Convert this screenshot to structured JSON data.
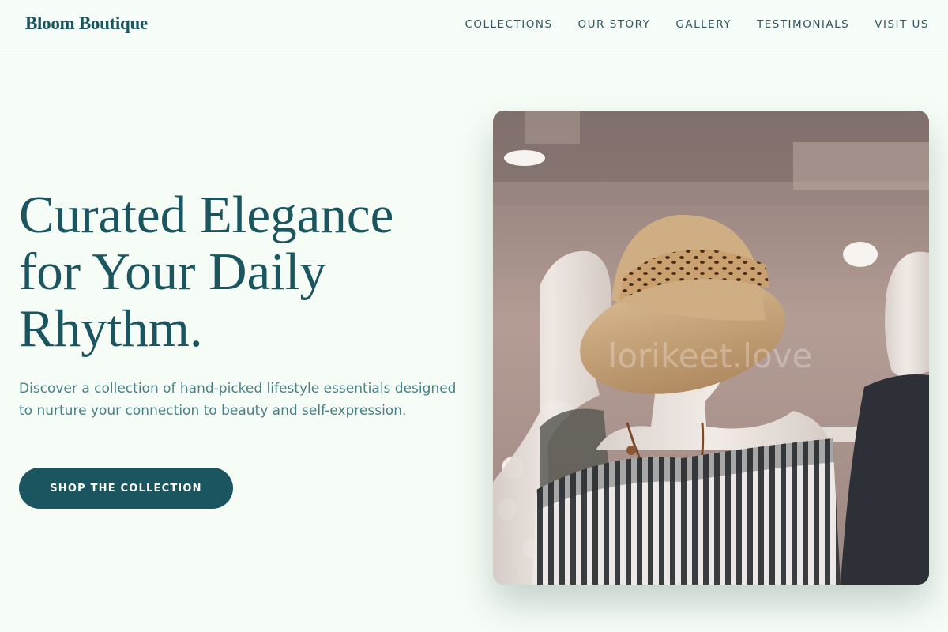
{
  "brand": {
    "name": "Bloom Boutique"
  },
  "nav": {
    "items": [
      {
        "label": "COLLECTIONS"
      },
      {
        "label": "OUR STORY"
      },
      {
        "label": "GALLERY"
      },
      {
        "label": "TESTIMONIALS"
      },
      {
        "label": "VISIT US"
      }
    ]
  },
  "hero": {
    "title_lines": [
      "Curated Elegance",
      "for Your Daily",
      "Rhythm."
    ],
    "subtitle": "Discover a collection of hand-picked lifestyle essentials designed to nurture your connection to beauty and self-expression.",
    "cta_label": "SHOP THE COLLECTION",
    "image": {
      "subject": "mannequins wearing a straw hat, beaded necklace and striped off-shoulder top",
      "watermark": "lorikeet.love"
    }
  },
  "colors": {
    "primary": "#1b5560",
    "background": "#f5fdf6",
    "subtitle_text": "#4a7f86",
    "nav_text": "#2d5660"
  }
}
